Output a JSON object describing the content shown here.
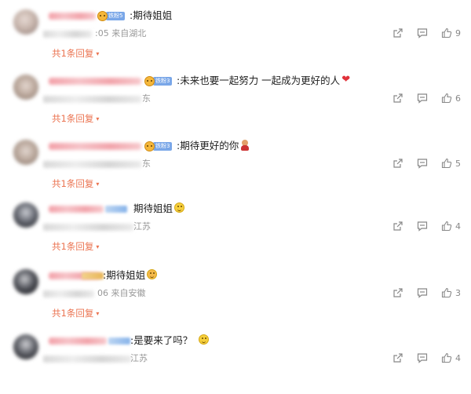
{
  "comments": [
    {
      "text": ":期待姐姐",
      "meta": ":05 来自湖北",
      "badge": "铁粉5",
      "likes": "9",
      "reply": "共1条回复",
      "emoji": ""
    },
    {
      "text": ":未来也要一起努力 一起成为更好的人",
      "meta": "东",
      "badge": "铁粉3",
      "likes": "6",
      "reply": "共1条回复",
      "emoji": "heart"
    },
    {
      "text": ":期待更好的你",
      "meta": "东",
      "badge": "铁粉3",
      "likes": "5",
      "reply": "共1条回复",
      "emoji": "figure"
    },
    {
      "text": "期待姐姐",
      "meta": "江苏",
      "badge": "",
      "likes": "4",
      "reply": "共1条回复",
      "emoji": "smile"
    },
    {
      "text": ":期待姐姐",
      "meta": "06 来自安徽",
      "badge": "",
      "likes": "3",
      "reply": "共1条回复",
      "emoji": "tongue"
    },
    {
      "text": ":是要来了吗？",
      "meta": "江苏",
      "badge": "",
      "likes": "4",
      "reply": "",
      "emoji": "smile"
    }
  ],
  "icons": {
    "share": "share-icon",
    "comment": "comment-icon",
    "like": "thumbs-up-icon",
    "caret": "▾"
  },
  "colors": {
    "reply": "#eb7350",
    "meta": "#999999",
    "text": "#222222",
    "badge": "#7aa7e8"
  }
}
